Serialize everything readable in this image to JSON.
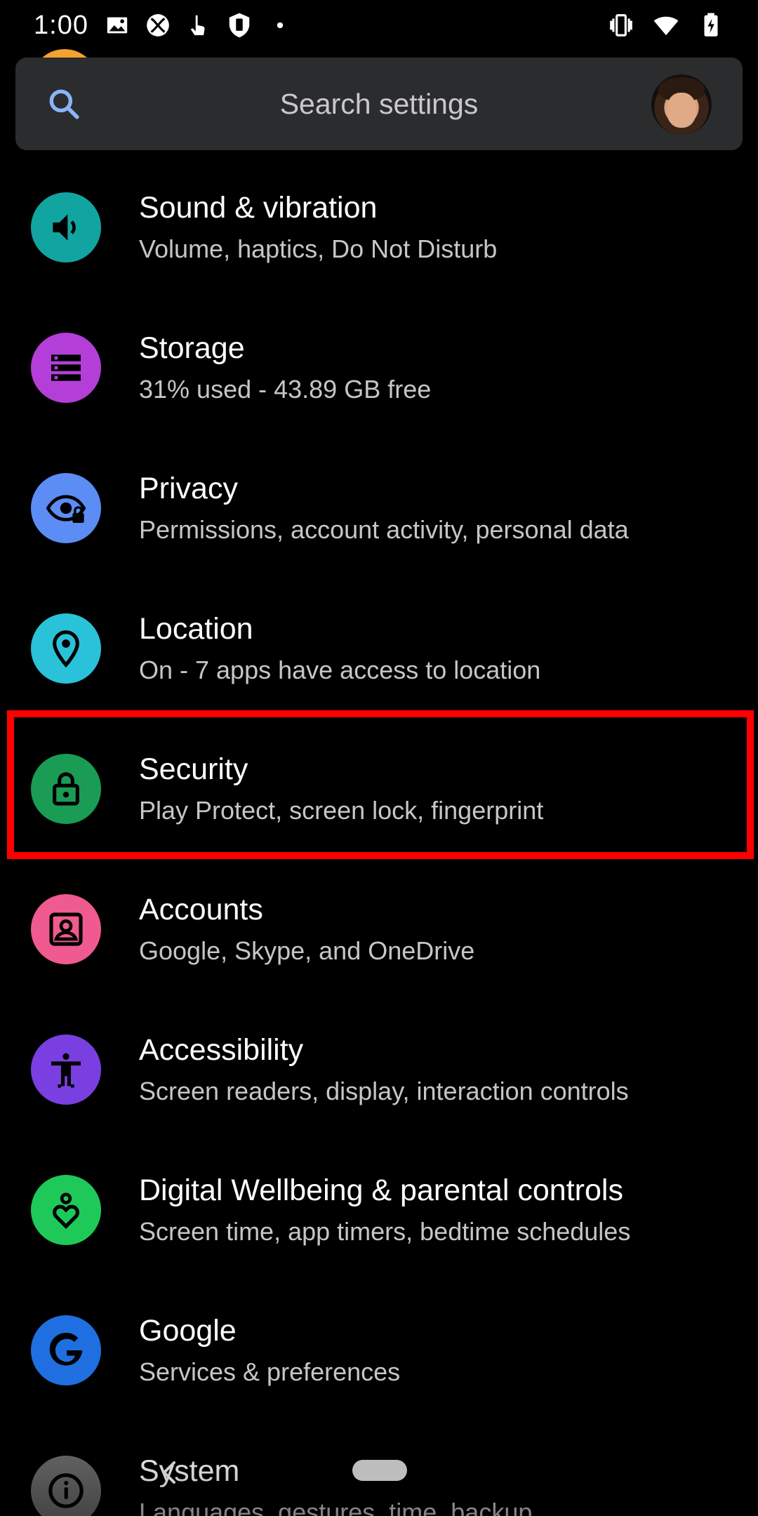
{
  "status_bar": {
    "time": "1:00",
    "left_icons": [
      "image-icon",
      "xbox-icon",
      "touch-icon",
      "phone-link-icon",
      "dot-icon"
    ],
    "right_icons": [
      "vibrate-icon",
      "wifi-icon",
      "battery-charging-icon"
    ]
  },
  "search": {
    "placeholder": "Search settings",
    "icon": "search-icon",
    "avatar": "account-avatar"
  },
  "items": [
    {
      "title": "Sound & vibration",
      "subtitle": "Volume, haptics, Do Not Disturb",
      "icon": "volume-icon",
      "color": "#12a4a0"
    },
    {
      "title": "Storage",
      "subtitle": "31% used - 43.89 GB free",
      "icon": "storage-icon",
      "color": "#b43fd8"
    },
    {
      "title": "Privacy",
      "subtitle": "Permissions, account activity, personal data",
      "icon": "privacy-eye-icon",
      "color": "#5b8df5"
    },
    {
      "title": "Location",
      "subtitle": "On - 7 apps have access to location",
      "icon": "location-pin-icon",
      "color": "#29c2d8"
    },
    {
      "title": "Security",
      "subtitle": "Play Protect, screen lock, fingerprint",
      "icon": "lock-icon",
      "color": "#1a9c55"
    },
    {
      "title": "Accounts",
      "subtitle": "Google, Skype, and OneDrive",
      "icon": "account-box-icon",
      "color": "#ef5a8f"
    },
    {
      "title": "Accessibility",
      "subtitle": "Screen readers, display, interaction controls",
      "icon": "accessibility-icon",
      "color": "#7a3fe0"
    },
    {
      "title": "Digital Wellbeing & parental controls",
      "subtitle": "Screen time, app timers, bedtime schedules",
      "icon": "wellbeing-heart-icon",
      "color": "#1ec95a"
    },
    {
      "title": "Google",
      "subtitle": "Services & preferences",
      "icon": "google-g-icon",
      "color": "#1f6fe0"
    },
    {
      "title": "System",
      "subtitle": "Languages, gestures, time, backup",
      "icon": "info-icon",
      "color": "#6b6b6b"
    }
  ],
  "highlight_color": "#ff0000"
}
